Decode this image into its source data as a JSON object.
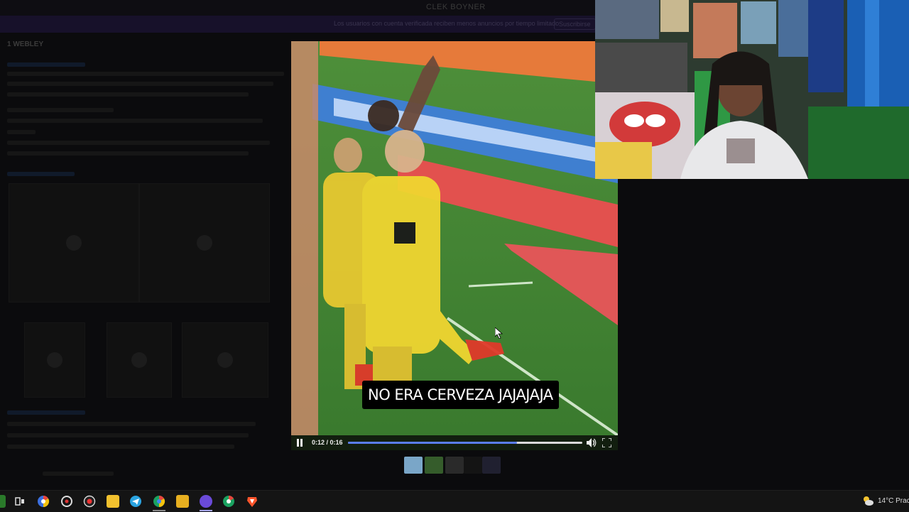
{
  "background_page": {
    "site_title": "CLEK BOYNER",
    "notice_text": "Los usuarios con cuenta verificada reciben menos anuncios por tiempo limitado",
    "notice_button": "Suscribirse",
    "section_label": "1 WEBLEY"
  },
  "player": {
    "caption": "NO ERA CERVEZA JAJAJAJA",
    "time_display": "0:12 / 0:16",
    "progress_fraction": 0.72,
    "state": "playing",
    "icons": [
      "pause-icon",
      "volume-icon",
      "fullscreen-icon"
    ]
  },
  "thumbnail_strip": {
    "count": 5,
    "colors": [
      "#7aa6c8",
      "#355c2b",
      "#2a2a2a",
      "#141414",
      "#202030"
    ]
  },
  "taskbar": {
    "icons": [
      "start-icon",
      "task-view-icon",
      "chrome-icon",
      "app-icon",
      "recording-icon",
      "notes-icon",
      "telegram-icon",
      "chrome-icon",
      "file-explorer-icon",
      "discord-icon",
      "chrome-icon",
      "brave-icon"
    ],
    "weather_text": "14°C Prac"
  },
  "colors": {
    "progress_fill": "#5a7df0",
    "caption_bg": "#000000",
    "taskbar_bg": "#141414"
  }
}
